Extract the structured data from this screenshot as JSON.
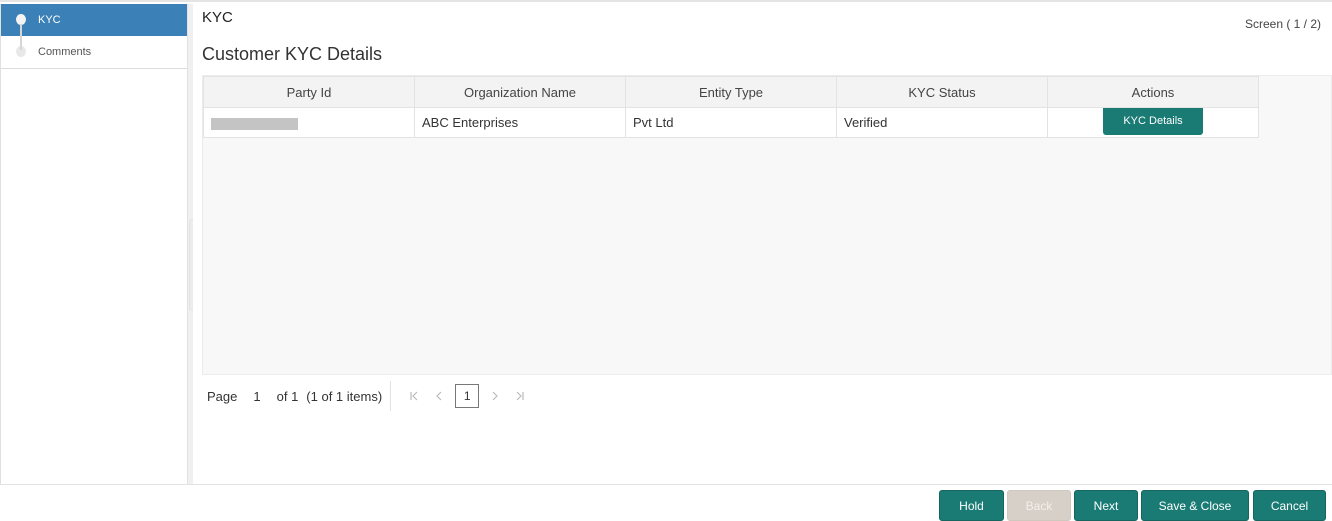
{
  "sidebar": {
    "items": [
      {
        "label": "KYC",
        "active": true
      },
      {
        "label": "Comments",
        "active": false
      }
    ]
  },
  "header": {
    "title": "KYC",
    "screen_counter": "Screen ( 1 / 2)"
  },
  "section": {
    "title": "Customer KYC Details"
  },
  "table": {
    "columns": [
      "Party Id",
      "Organization Name",
      "Entity Type",
      "KYC Status",
      "Actions"
    ],
    "rows": [
      {
        "party_id": "",
        "organization_name": "ABC Enterprises",
        "entity_type": "Pvt Ltd",
        "kyc_status": "Verified",
        "action_label": "KYC Details"
      }
    ]
  },
  "pager": {
    "page_label": "Page",
    "page_value": "1",
    "of_label": "of 1",
    "items_label": "(1 of 1 items)",
    "current_page": "1",
    "first_icon": "K",
    "prev_icon": "<",
    "next_icon": ">",
    "last_icon": ">|"
  },
  "footer": {
    "buttons": [
      {
        "label": "Hold",
        "enabled": true
      },
      {
        "label": "Back",
        "enabled": false
      },
      {
        "label": "Next",
        "enabled": true
      },
      {
        "label": "Save & Close",
        "enabled": true
      },
      {
        "label": "Cancel",
        "enabled": true
      }
    ]
  },
  "colors": {
    "accent": "#1a7b74",
    "nav_active": "#3b80b6",
    "disabled": "#d6d0c8"
  }
}
